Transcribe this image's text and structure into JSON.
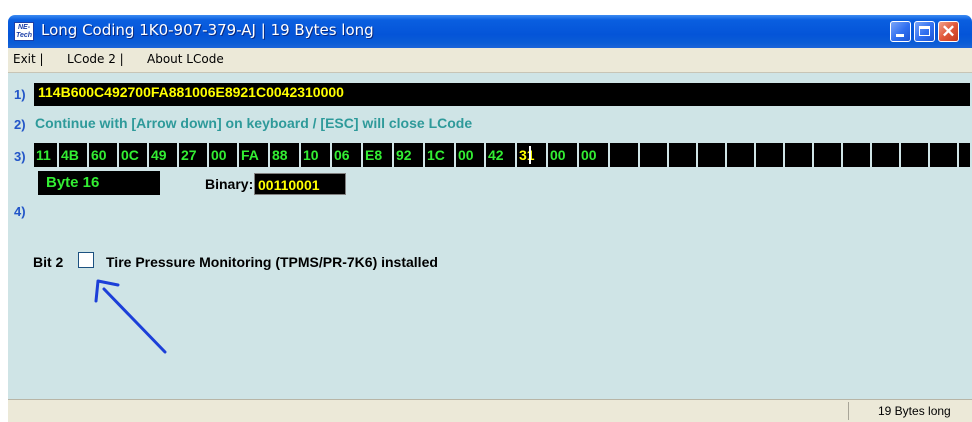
{
  "window": {
    "title": "Long Coding  1K0-907-379-AJ | 19 Bytes long",
    "icon_text": "NE-Tech",
    "buttons": [
      "minimize-icon",
      "maximize-icon",
      "close-icon"
    ],
    "close_glyph": "✕"
  },
  "menu": {
    "items": [
      {
        "label": "Exit |"
      },
      {
        "label": "LCode 2 |"
      },
      {
        "label": "About LCode"
      }
    ]
  },
  "main": {
    "row1_number": "1)",
    "coding_value": "114B600C492700FA881006E8921C0042310000",
    "row2_number": "2)",
    "info_text": "Continue with [Arrow down] on keyboard / [ESC] will close LCode",
    "row3_number": "3)",
    "bytes": [
      "11",
      "4B",
      "60",
      "0C",
      "49",
      "27",
      "00",
      "FA",
      "88",
      "10",
      "06",
      "E8",
      "92",
      "1C",
      "00",
      "42",
      "31",
      "00",
      "00",
      "",
      "",
      "",
      "",
      "",
      "",
      "",
      "",
      "",
      "",
      "",
      "",
      "",
      ""
    ],
    "selected_byte_index": 16,
    "byte_label": "Byte 16",
    "binary_label": "Binary:",
    "binary_value": "00110001",
    "row4_number": "4)",
    "bit_label": "Bit 2",
    "bit_checked": false,
    "bit_description": "Tire Pressure Monitoring (TPMS/PR-7K6) installed",
    "annotation": "arrow-icon"
  },
  "status": {
    "right_text": "19 Bytes long"
  },
  "colors": {
    "title_bar": "#0a5fe0",
    "client_bg": "#cfe4e6",
    "byte_text": "#33ee33",
    "highlight_text": "#ffff00",
    "row_number": "#2255c8",
    "info_text": "#2e9a9a",
    "annotation_arrow": "#1c3fd8"
  }
}
